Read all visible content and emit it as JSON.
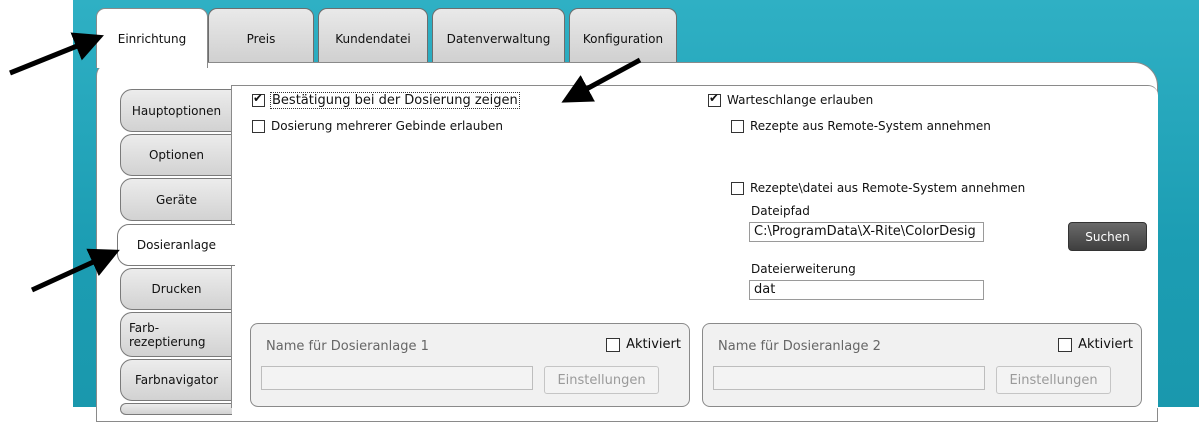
{
  "tabs": [
    "Einrichtung",
    "Preis",
    "Kundendatei",
    "Datenverwaltung",
    "Konfiguration"
  ],
  "active_tab": "Einrichtung",
  "subnav": [
    "Hauptoptionen",
    "Optionen",
    "Geräte",
    "Dosieranlage",
    "Drucken",
    "Farb-\nrezeptierung",
    "Farbnavigator"
  ],
  "active_subnav": "Dosieranlage",
  "options": {
    "confirm_dosing": {
      "label": "Bestätigung bei der Dosierung zeigen",
      "checked": true
    },
    "multi_container": {
      "label": "Dosierung mehrerer Gebinde erlauben",
      "checked": false
    },
    "queue": {
      "label": "Warteschlange erlauben",
      "checked": true
    },
    "remote_recipes": {
      "label": "Rezepte aus Remote-System annehmen",
      "checked": false
    },
    "remote_file": {
      "label": "Rezepte\\datei aus Remote-System annehmen",
      "checked": false
    }
  },
  "file_path": {
    "label": "Dateipfad",
    "value": "C:\\ProgramData\\X-Rite\\ColorDesig"
  },
  "search_button": "Suchen",
  "file_ext": {
    "label": "Dateierweiterung",
    "value": "dat"
  },
  "dosing_units": [
    {
      "name_placeholder": "Name für Dosieranlage 1",
      "activated_label": "Aktiviert",
      "settings_button": "Einstellungen"
    },
    {
      "name_placeholder": "Name für Dosieranlage 2",
      "activated_label": "Aktiviert",
      "settings_button": "Einstellungen"
    }
  ],
  "colors": {
    "teal": "#1c9db3",
    "button_dark": "#4a4a4a",
    "arrow": "#000000"
  }
}
